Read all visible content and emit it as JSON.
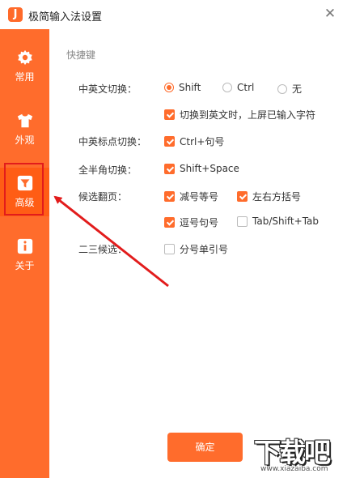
{
  "window": {
    "title": "极简输入法设置",
    "app_icon_letter": "J",
    "close_glyph": "✕"
  },
  "sidebar": {
    "items": [
      {
        "label": "常用",
        "icon": "gear-icon"
      },
      {
        "label": "外观",
        "icon": "shirt-icon"
      },
      {
        "label": "高级",
        "icon": "filter-icon",
        "active": true
      },
      {
        "label": "关于",
        "icon": "info-icon"
      }
    ]
  },
  "section": {
    "title": "快捷键"
  },
  "settings": {
    "lang_switch": {
      "label": "中英文切换：",
      "options": [
        "Shift",
        "Ctrl",
        "无"
      ],
      "selected": "Shift",
      "sub_option": {
        "label": "切换到英文时，上屏已输入字符",
        "checked": true
      }
    },
    "punct_switch": {
      "label": "中英标点切换：",
      "option": {
        "label": "Ctrl+句号",
        "checked": true
      }
    },
    "width_switch": {
      "label": "全半角切换：",
      "option": {
        "label": "Shift+Space",
        "checked": true
      }
    },
    "paging": {
      "label": "候选翻页：",
      "options": [
        {
          "label": "减号等号",
          "checked": true
        },
        {
          "label": "左右方括号",
          "checked": true
        },
        {
          "label": "逗号句号",
          "checked": true
        },
        {
          "label": "Tab/Shift+Tab",
          "checked": false
        }
      ]
    },
    "second_third": {
      "label": "二三候选：",
      "option": {
        "label": "分号单引号",
        "checked": false
      }
    }
  },
  "footer": {
    "ok_label": "确定"
  },
  "watermark": {
    "text": "下载吧",
    "url": "www.xiazaiba.com"
  },
  "colors": {
    "accent": "#ff6c2c",
    "annotation": "#e21c1c"
  }
}
